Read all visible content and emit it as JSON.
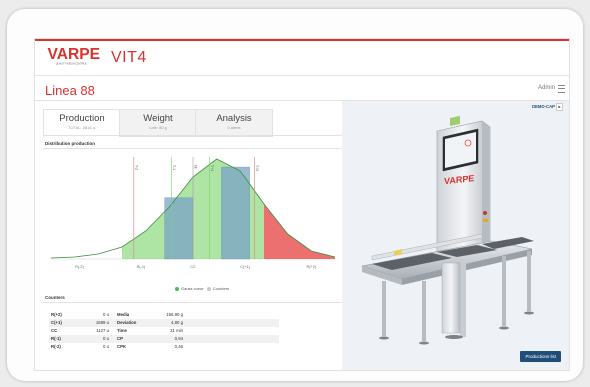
{
  "app": {
    "brand": "VARPE",
    "brand_tagline": "QUALITY WEIGH CONTROL",
    "product": "VIT4",
    "line_title": "Linea 88",
    "user_label": "Admin"
  },
  "tabs": [
    {
      "label": "Production",
      "sub": "TOTAL: 2816 u.",
      "active": true
    },
    {
      "label": "Weight",
      "sub": "Lote: 80 g",
      "active": false
    },
    {
      "label": "Analysis",
      "sub": "0 alerts",
      "active": false
    }
  ],
  "distribution": {
    "title": "Distribution production",
    "legend": [
      {
        "label": "Gauss curve",
        "color": "#4cbb4c"
      },
      {
        "label": "Counters",
        "color": "#c8c8c8"
      }
    ]
  },
  "chart_data": {
    "type": "bar",
    "categories": [
      "R(-2)",
      "R(-1)",
      "CC",
      "C(+1)",
      "R(+2)"
    ],
    "values": [
      0,
      0,
      1127,
      1689,
      0
    ],
    "gauss_curve": {
      "x": [
        0,
        0.5,
        1,
        1.5,
        2,
        2.5,
        3,
        3.5,
        4,
        4.5,
        5,
        5.5,
        6
      ],
      "y": [
        0.01,
        0.02,
        0.05,
        0.12,
        0.28,
        0.52,
        0.82,
        1.0,
        0.88,
        0.55,
        0.25,
        0.08,
        0.02
      ]
    },
    "threshold_labels": [
      "T-2",
      "T-1",
      "Nt",
      "T+1",
      "T+2"
    ],
    "legend": [
      "Gauss curve",
      "Counters"
    ],
    "colors": {
      "bar": "#7aa3c8",
      "gauss": "#6ccf5b",
      "red_zone": "#e84c4c",
      "green_line": "#7ad17a"
    }
  },
  "counters": {
    "title": "Counters",
    "rows": [
      {
        "label": "R(+2)",
        "value": "0",
        "unit": "u",
        "stat": "Media",
        "stat_value": "156,90 g"
      },
      {
        "label": "C(+1)",
        "value": "1689",
        "unit": "u",
        "stat": "Deviation",
        "stat_value": "4,80 g"
      },
      {
        "label": "CC",
        "value": "1127",
        "unit": "u",
        "stat": "Time",
        "stat_value": "31 min"
      },
      {
        "label": "R(-1)",
        "value": "0",
        "unit": "u",
        "stat": "CP",
        "stat_value": "0,94"
      },
      {
        "label": "R(-2)",
        "value": "0",
        "unit": "u",
        "stat": "CPK",
        "stat_value": "0,46"
      }
    ]
  },
  "machine": {
    "demo_label": "DEMO-CAP",
    "brand_on_machine": "VARPE",
    "productions_list_button": "Productions list"
  }
}
